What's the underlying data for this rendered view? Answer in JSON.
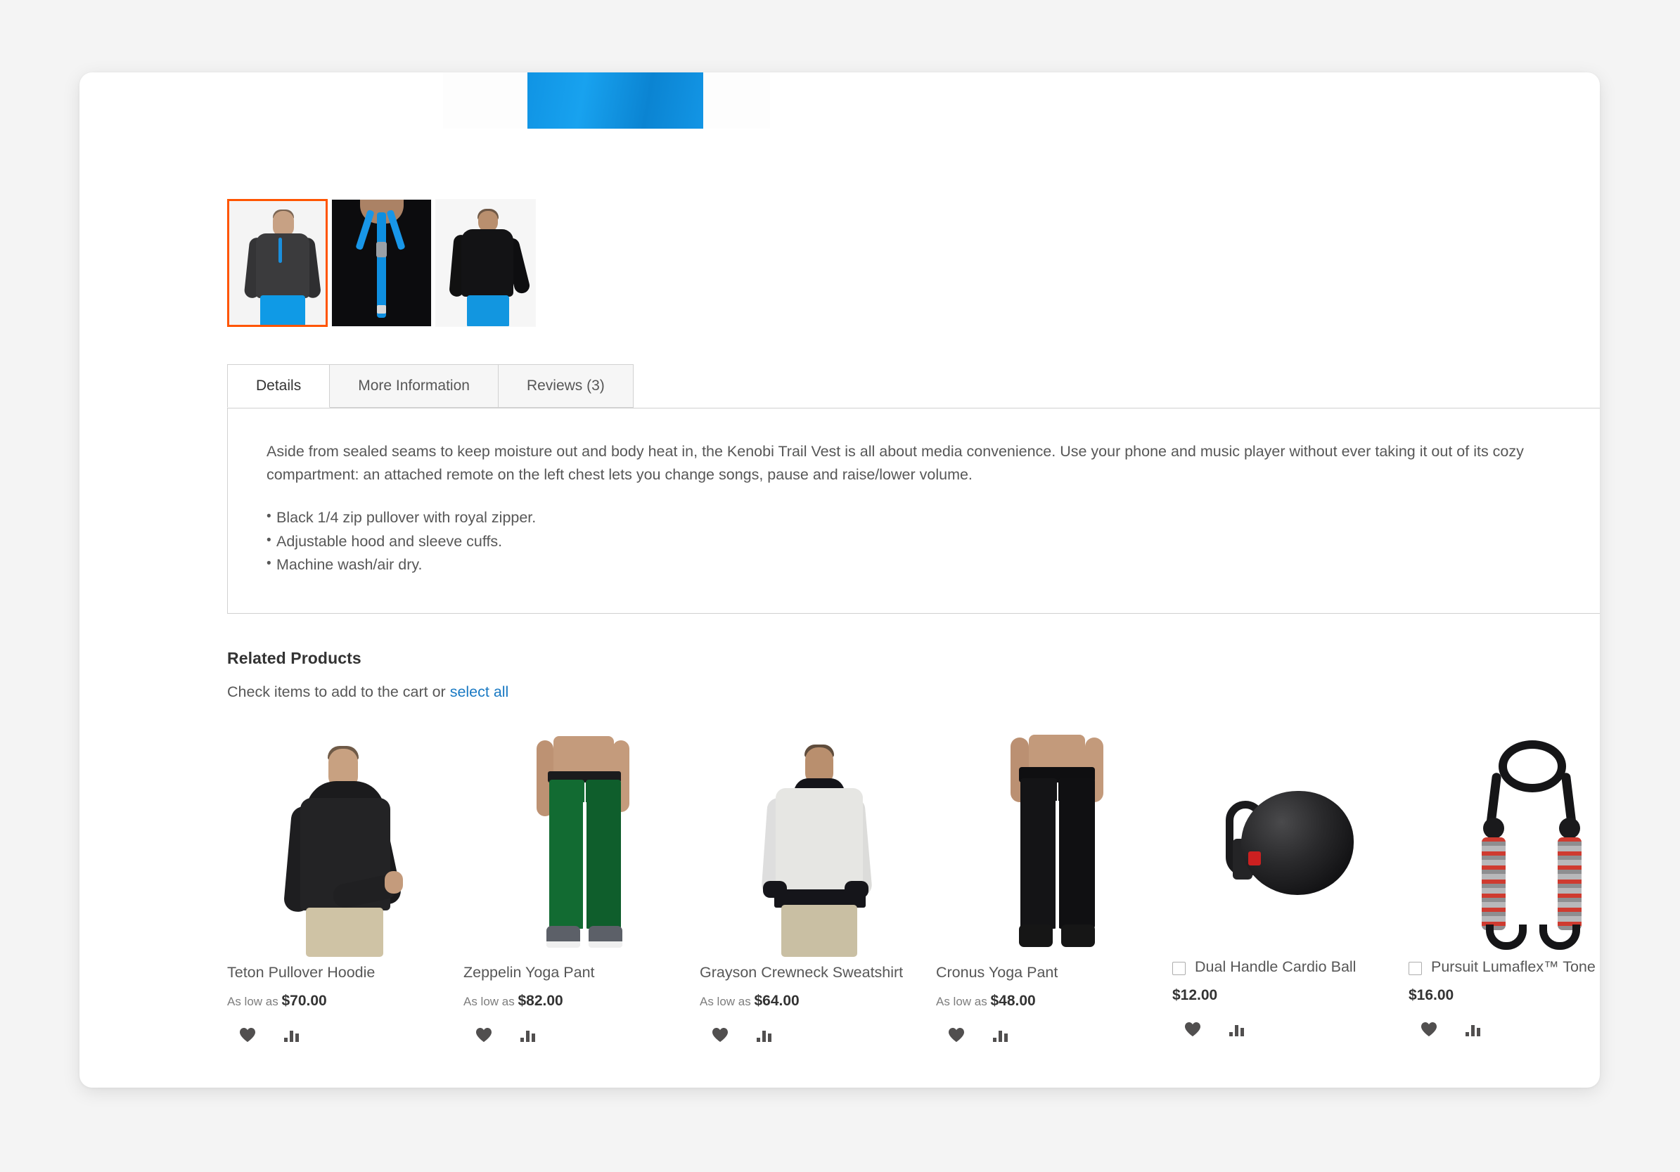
{
  "gallery": {
    "thumbnails": [
      {
        "name": "front-view",
        "selected": true
      },
      {
        "name": "zipper-closeup",
        "selected": false
      },
      {
        "name": "back-view",
        "selected": false
      }
    ]
  },
  "tabs": [
    {
      "label": "Details",
      "active": true
    },
    {
      "label": "More Information",
      "active": false
    },
    {
      "label": "Reviews (3)",
      "active": false
    }
  ],
  "details": {
    "paragraph": "Aside from sealed seams to keep moisture out and body heat in, the Kenobi Trail Vest is all about media convenience. Use your phone and music player without ever taking it out of its cozy compartment: an attached remote on the left chest lets you change songs, pause and raise/lower volume.",
    "bullets": [
      "Black 1/4 zip pullover with royal zipper.",
      "Adjustable hood and sleeve cuffs.",
      "Machine wash/air dry."
    ]
  },
  "related": {
    "title": "Related Products",
    "subtitle_prefix": "Check items to add to the cart or ",
    "select_all_label": "select all",
    "products": [
      {
        "name": "Teton Pullover Hoodie",
        "price_prefix": "As low as ",
        "price": "$70.00",
        "has_checkbox": false,
        "wishlist_icon": "heart-icon",
        "compare_icon": "compare-icon"
      },
      {
        "name": "Zeppelin Yoga Pant",
        "price_prefix": "As low as ",
        "price": "$82.00",
        "has_checkbox": false,
        "wishlist_icon": "heart-icon",
        "compare_icon": "compare-icon"
      },
      {
        "name": "Grayson Crewneck Sweatshirt",
        "price_prefix": "As low as ",
        "price": "$64.00",
        "has_checkbox": false,
        "wishlist_icon": "heart-icon",
        "compare_icon": "compare-icon"
      },
      {
        "name": "Cronus Yoga Pant",
        "price_prefix": "As low as ",
        "price": "$48.00",
        "has_checkbox": false,
        "wishlist_icon": "heart-icon",
        "compare_icon": "compare-icon"
      },
      {
        "name": "Dual Handle Cardio Ball",
        "price_prefix": "",
        "price": "$12.00",
        "has_checkbox": true,
        "checked": false,
        "wishlist_icon": "heart-icon",
        "compare_icon": "compare-icon"
      },
      {
        "name": "Pursuit Lumaflex™ Tone Band",
        "price_prefix": "",
        "price": "$16.00",
        "has_checkbox": true,
        "checked": false,
        "wishlist_icon": "heart-icon",
        "compare_icon": "compare-icon"
      }
    ]
  },
  "colors": {
    "page_background": "#f4f4f4",
    "card_background": "#ffffff",
    "accent_orange": "#ff5501",
    "link_blue": "#1979c3",
    "text_primary": "#333333",
    "text_secondary": "#575757",
    "border_gray": "#d1d1d1",
    "icon_gray": "#514f4f"
  }
}
